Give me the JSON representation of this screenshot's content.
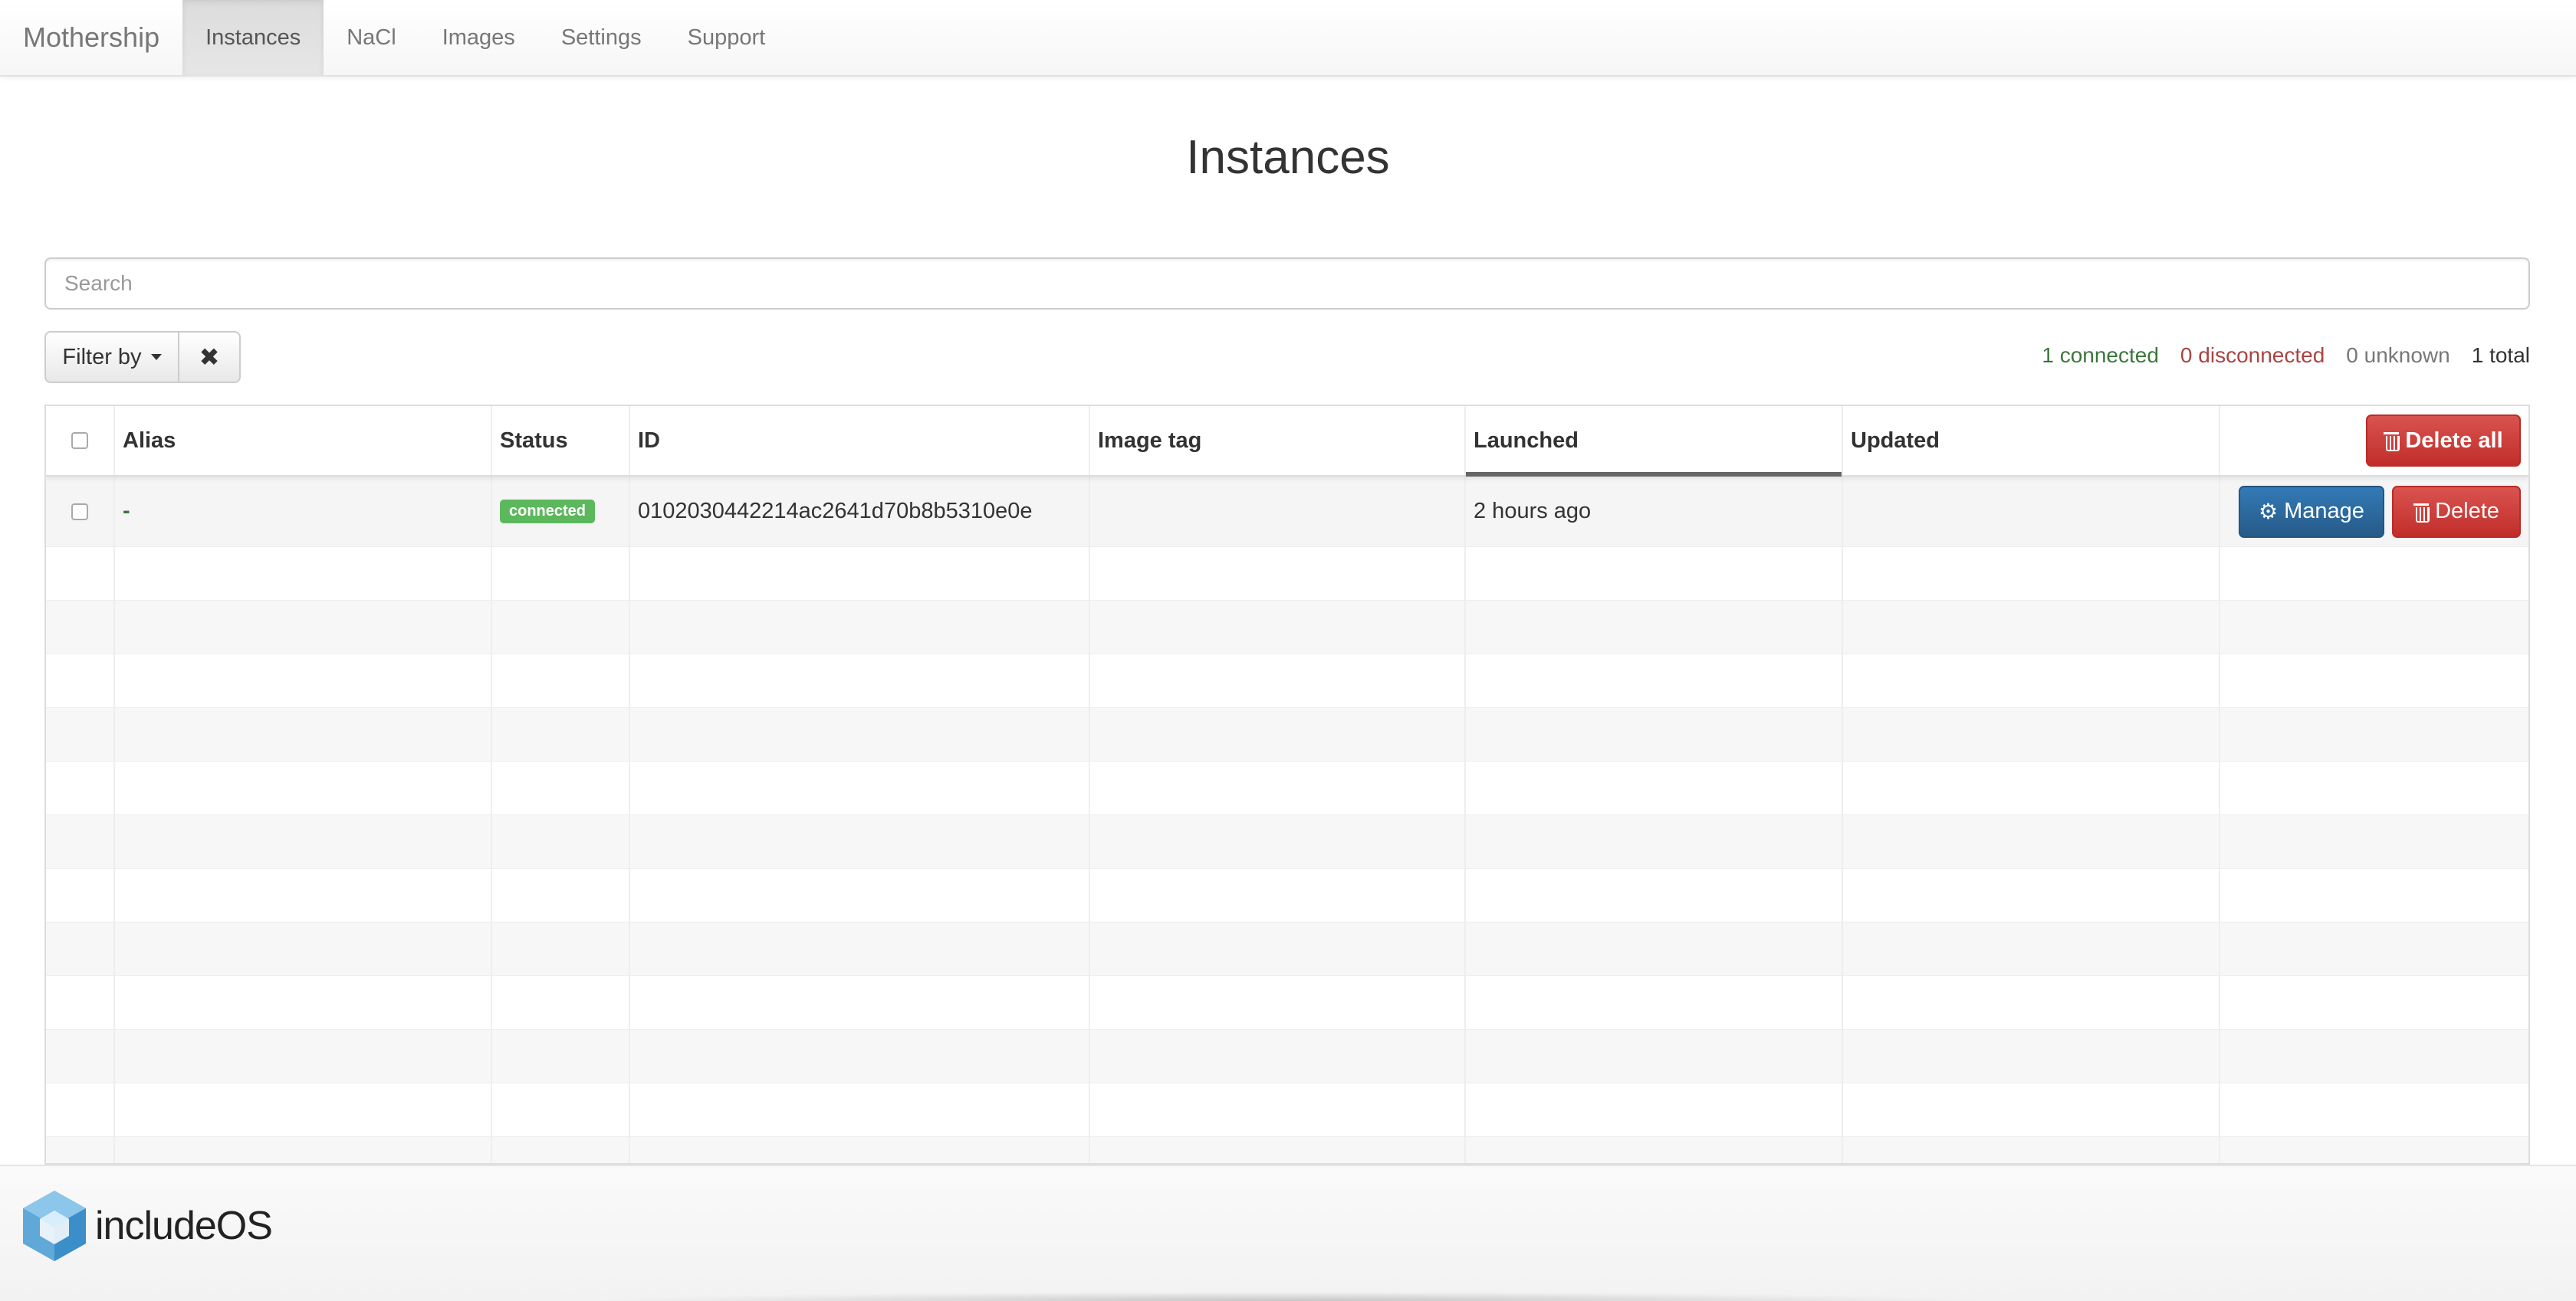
{
  "navbar": {
    "brand": "Mothership",
    "items": [
      {
        "label": "Instances",
        "active": true
      },
      {
        "label": "NaCl",
        "active": false
      },
      {
        "label": "Images",
        "active": false
      },
      {
        "label": "Settings",
        "active": false
      },
      {
        "label": "Support",
        "active": false
      }
    ]
  },
  "page": {
    "title": "Instances"
  },
  "search": {
    "placeholder": "Search",
    "value": ""
  },
  "filter": {
    "label": "Filter by",
    "clear_icon": "close-icon"
  },
  "stats": {
    "connected": "1 connected",
    "disconnected": "0 disconnected",
    "unknown": "0 unknown",
    "total": "1 total"
  },
  "table": {
    "columns": [
      "Alias",
      "Status",
      "ID",
      "Image tag",
      "Launched",
      "Updated"
    ],
    "sorted_column": "Launched",
    "delete_all_label": "Delete all",
    "rows": [
      {
        "alias": "-",
        "status": "connected",
        "id": "0102030442214ac2641d70b8b5310e0e",
        "image_tag": "",
        "launched": "2 hours ago",
        "updated": "",
        "manage_label": "Manage",
        "delete_label": "Delete"
      }
    ]
  },
  "footer": {
    "logo_text_1": "include",
    "logo_text_2": "OS"
  },
  "colors": {
    "success": "#5cb85c",
    "danger": "#d9534f",
    "primary": "#337ab7",
    "connected_text": "#3c763d",
    "disconnected_text": "#a94442"
  }
}
